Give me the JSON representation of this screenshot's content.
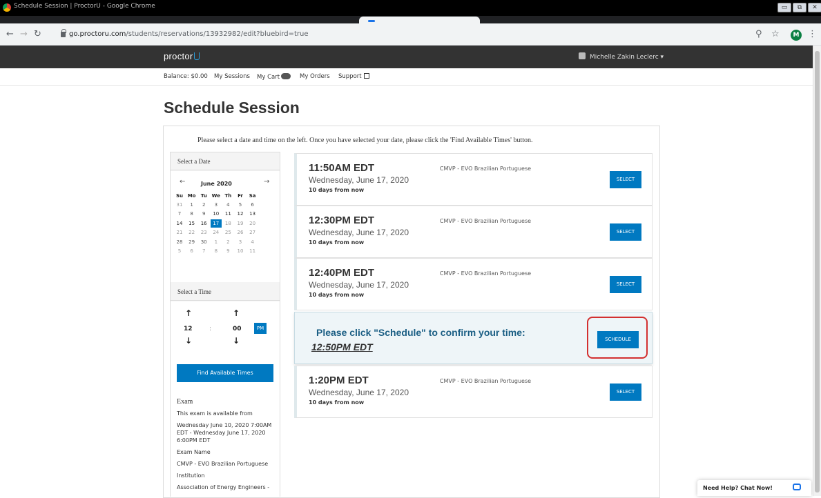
{
  "browser": {
    "window_title": "Schedule Session | ProctorU - Google Chrome",
    "url_host": "go.proctoru.com",
    "url_path": "/students/reservations/13932982/edit?bluebird=true",
    "profile_initial": "M"
  },
  "header": {
    "logo": "proctor",
    "user_name": "Michelle Zakin Leclerc ▾"
  },
  "subnav": {
    "balance": "Balance: $0.00",
    "sessions": "My Sessions",
    "cart": "My Cart",
    "orders": "My Orders",
    "support": "Support"
  },
  "page": {
    "title": "Schedule Session",
    "instructions": "Please select a date and time on the left. Once you have selected your date, please click the 'Find Available Times' button."
  },
  "calendar": {
    "heading": "Select a Date",
    "month": "June 2020",
    "prev": "←",
    "next": "→",
    "dow": [
      "Su",
      "Mo",
      "Tu",
      "We",
      "Th",
      "Fr",
      "Sa"
    ],
    "weeks": [
      [
        "31",
        "1",
        "2",
        "3",
        "4",
        "5",
        "6"
      ],
      [
        "7",
        "8",
        "9",
        "10",
        "11",
        "12",
        "13"
      ],
      [
        "14",
        "15",
        "16",
        "17",
        "18",
        "19",
        "20"
      ],
      [
        "21",
        "22",
        "23",
        "24",
        "25",
        "26",
        "27"
      ],
      [
        "28",
        "29",
        "30",
        "1",
        "2",
        "3",
        "4"
      ],
      [
        "5",
        "6",
        "7",
        "8",
        "9",
        "10",
        "11"
      ]
    ],
    "selected": "17"
  },
  "time_picker": {
    "heading": "Select a Time",
    "hour": "12",
    "separator": ":",
    "minute": "00",
    "meridiem": "PM"
  },
  "find_button": "Find Available Times",
  "exam_info": {
    "heading": "Exam",
    "availability_label": "This exam is available from",
    "availability": "Wednesday June 10, 2020 7:00AM EDT - Wednesday June 17, 2020 6:00PM EDT",
    "name_label": "Exam Name",
    "name": "CMVP - EVO Brazilian Portuguese",
    "institution_label": "Institution",
    "institution": "Association of Energy Engineers -"
  },
  "slots": [
    {
      "time": "11:50AM EDT",
      "date": "Wednesday, June 17, 2020",
      "away": "10 days from now",
      "exam": "CMVP - EVO Brazilian Portuguese",
      "button": "SELECT"
    },
    {
      "time": "12:30PM EDT",
      "date": "Wednesday, June 17, 2020",
      "away": "10 days from now",
      "exam": "CMVP - EVO Brazilian Portuguese",
      "button": "SELECT"
    },
    {
      "time": "12:40PM EDT",
      "date": "Wednesday, June 17, 2020",
      "away": "10 days from now",
      "exam": "CMVP - EVO Brazilian Portuguese",
      "button": "SELECT"
    },
    {
      "time": "1:20PM EDT",
      "date": "Wednesday, June 17, 2020",
      "away": "10 days from now",
      "exam": "CMVP - EVO Brazilian Portuguese",
      "button": "SELECT"
    }
  ],
  "confirm": {
    "message": "Please click \"Schedule\" to confirm your time:",
    "time": "12:50PM EDT",
    "button": "SCHEDULE"
  },
  "chat": {
    "label": "Need Help? Chat Now!"
  },
  "colors": {
    "accent": "#0079c1",
    "header_bg": "#333333",
    "confirm_text": "#1a5e84",
    "annotation": "#d32f2f"
  }
}
